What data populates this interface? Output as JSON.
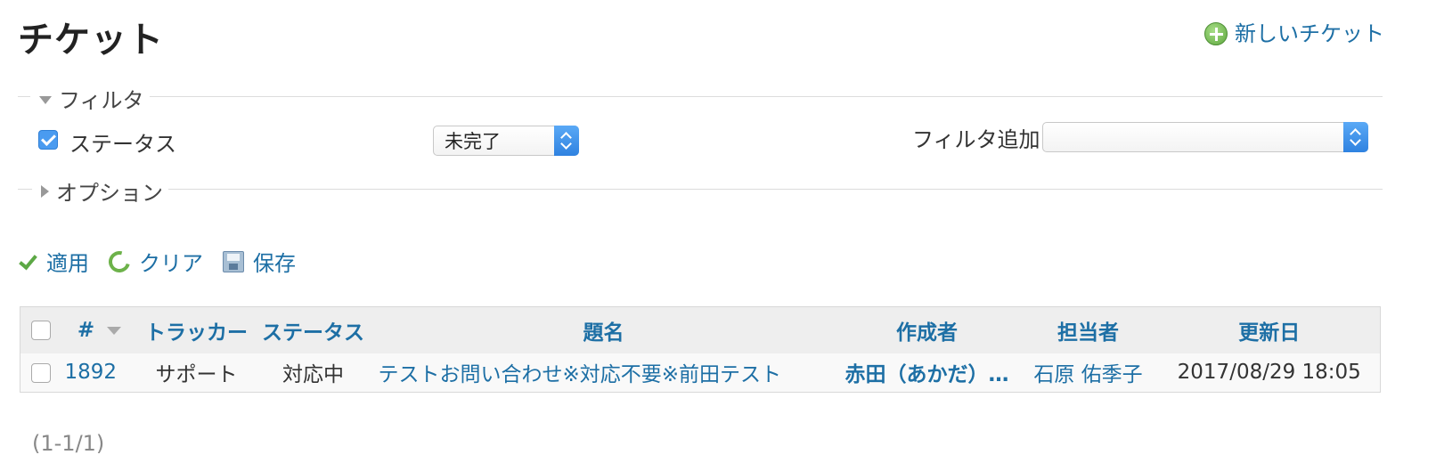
{
  "page": {
    "title": "チケット",
    "new_issue_label": "新しいチケット"
  },
  "filters": {
    "legend": "フィルタ",
    "status_label": "ステータス",
    "status_value": "未完了",
    "add_filter_label": "フィルタ追加",
    "add_filter_value": ""
  },
  "options": {
    "legend": "オプション"
  },
  "actions": {
    "apply": "適用",
    "clear": "クリア",
    "save": "保存"
  },
  "table": {
    "headers": {
      "id": "#",
      "tracker": "トラッカー",
      "status": "ステータス",
      "subject": "題名",
      "author": "作成者",
      "assignee": "担当者",
      "updated": "更新日"
    },
    "rows": [
      {
        "id": "1892",
        "tracker": "サポート",
        "status": "対応中",
        "subject": "テストお問い合わせ※対応不要※前田テスト",
        "author": "赤田（あかだ）…",
        "assignee": "石原 佑季子",
        "updated": "2017/08/29 18:05"
      }
    ]
  },
  "pagination": {
    "text": "(1-1/1)"
  },
  "colors": {
    "link": "#1d6fa5",
    "accent_blue": "#4a9bf0",
    "green": "#5ca845"
  }
}
